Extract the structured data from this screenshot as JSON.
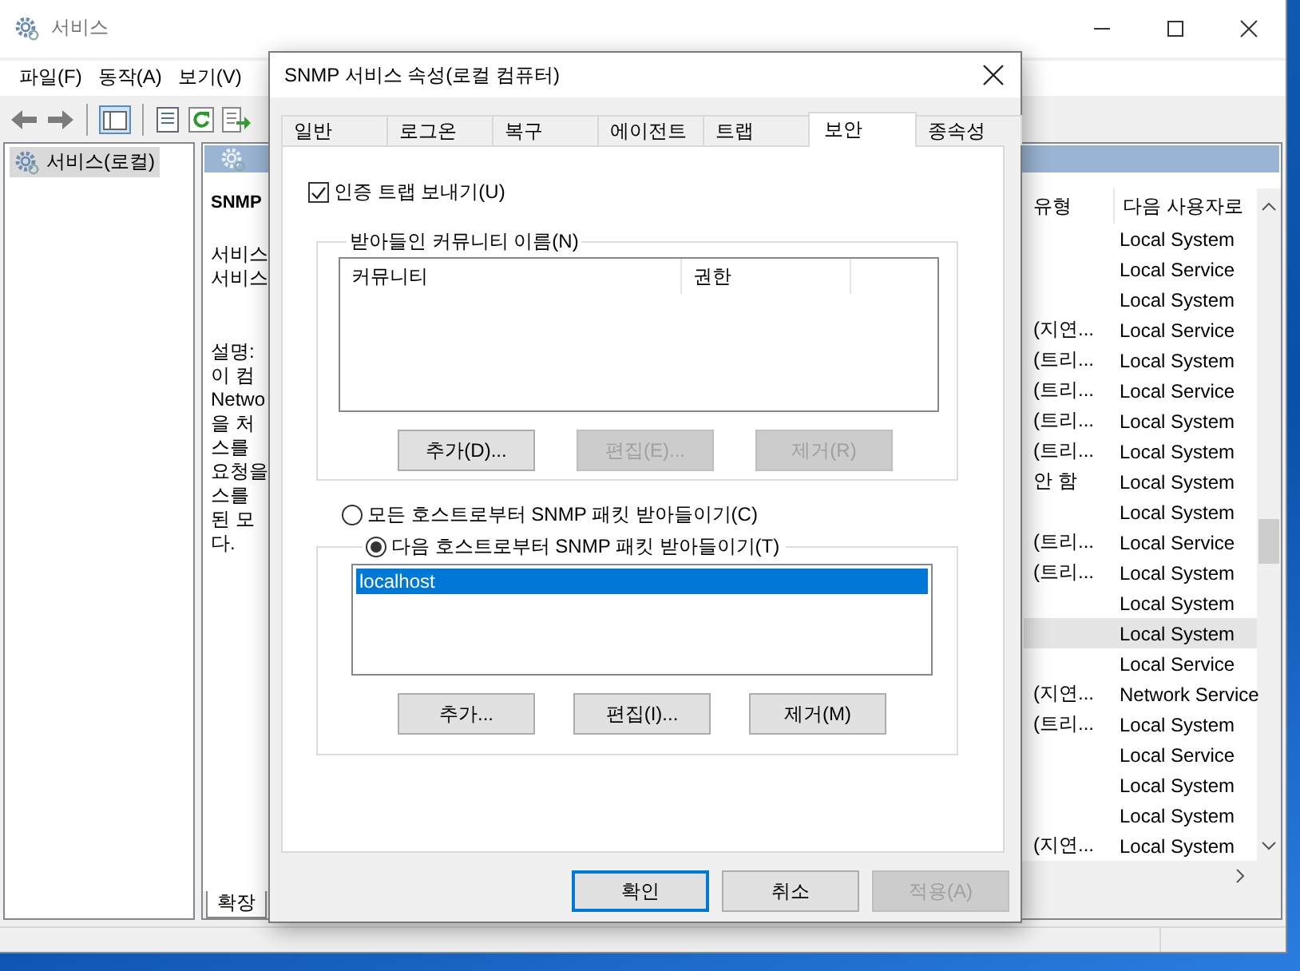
{
  "main_window": {
    "title": "서비스",
    "menu": [
      "파일(F)",
      "동작(A)",
      "보기(V)"
    ],
    "tree": [
      {
        "label": "서비스(로컬)",
        "selected": true
      }
    ],
    "detail": {
      "service_name": "SNMP",
      "lines": [
        "서비스",
        "서비스"
      ],
      "description_label": "설명:",
      "description_lines": [
        "이 컴",
        "Netwo",
        "을 처",
        "스를",
        "요청을",
        "스를",
        "된 모",
        "다."
      ]
    },
    "table": {
      "columns": [
        "유형",
        "다음 사용자로"
      ],
      "rows": [
        {
          "logon": "Local System",
          "selected": false
        },
        {
          "logon": "Local Service",
          "selected": false
        },
        {
          "logon": "Local System",
          "selected": false
        },
        {
          "startup": "(지연...",
          "logon": "Local Service",
          "selected": false
        },
        {
          "startup": "(트리...",
          "logon": "Local System",
          "selected": false
        },
        {
          "startup": "(트리...",
          "logon": "Local Service",
          "selected": false
        },
        {
          "startup": "(트리...",
          "logon": "Local System",
          "selected": false
        },
        {
          "startup": "(트리...",
          "logon": "Local System",
          "selected": false
        },
        {
          "startup": "안 함",
          "logon": "Local System",
          "selected": false
        },
        {
          "logon": "Local System",
          "selected": false
        },
        {
          "startup": "(트리...",
          "logon": "Local Service",
          "selected": false
        },
        {
          "startup": "(트리...",
          "logon": "Local System",
          "selected": false
        },
        {
          "logon": "Local System",
          "selected": false
        },
        {
          "logon": "Local System",
          "selected": true
        },
        {
          "logon": "Local Service",
          "selected": false
        },
        {
          "startup": "(지연...",
          "logon": "Network Service",
          "selected": false
        },
        {
          "startup": "(트리...",
          "logon": "Local System",
          "selected": false
        },
        {
          "logon": "Local Service",
          "selected": false
        },
        {
          "logon": "Local System",
          "selected": false
        },
        {
          "logon": "Local System",
          "selected": false
        },
        {
          "startup": "(지연...",
          "logon": "Local System",
          "selected": false
        }
      ]
    },
    "view_tabs": [
      {
        "label": "확장"
      }
    ]
  },
  "dialog": {
    "title": "SNMP 서비스 속성(로컬 컴퓨터)",
    "tabs": [
      {
        "label": "일반",
        "selected": false
      },
      {
        "label": "로그온",
        "selected": false
      },
      {
        "label": "복구",
        "selected": false
      },
      {
        "label": "에이전트",
        "selected": false
      },
      {
        "label": "트랩",
        "selected": false
      },
      {
        "label": "보안",
        "selected": true
      },
      {
        "label": "종속성",
        "selected": false
      }
    ],
    "send_auth_trap": {
      "label": "인증 트랩 보내기(U)",
      "checked": true
    },
    "communities": {
      "title": "받아들인 커뮤니티 이름(N)",
      "columns": [
        "커뮤니티",
        "권한"
      ],
      "buttons": [
        {
          "label": "추가(D)...",
          "disabled": false
        },
        {
          "label": "편집(E)...",
          "disabled": true
        },
        {
          "label": "제거(R)",
          "disabled": true
        }
      ]
    },
    "host_options": [
      {
        "label": "모든 호스트로부터 SNMP 패킷 받아들이기(C)",
        "selected": false
      },
      {
        "label": "다음 호스트로부터 SNMP 패킷 받아들이기(T)",
        "selected": true
      }
    ],
    "hosts": {
      "items": [
        {
          "label": "localhost",
          "selected": true
        }
      ],
      "buttons": [
        {
          "label": "추가...",
          "disabled": false
        },
        {
          "label": "편집(I)...",
          "disabled": false
        },
        {
          "label": "제거(M)",
          "disabled": false
        }
      ]
    },
    "footer_buttons": [
      {
        "label": "확인",
        "default": true,
        "disabled": false
      },
      {
        "label": "취소",
        "default": false,
        "disabled": false
      },
      {
        "label": "적용(A)",
        "default": false,
        "disabled": true
      }
    ]
  }
}
